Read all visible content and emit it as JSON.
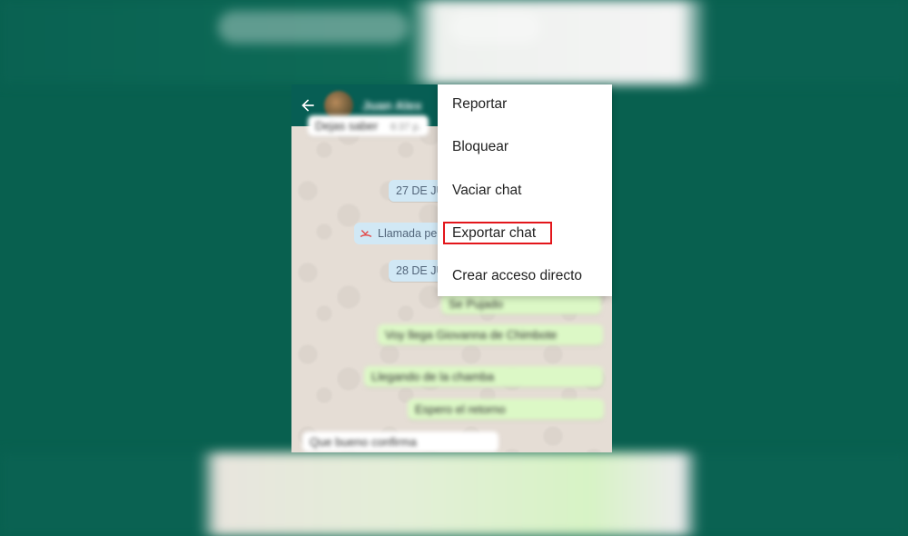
{
  "header": {
    "back_icon": "arrow-back-icon",
    "avatar_icon": "contact-avatar",
    "contact_name": "Juan Alex"
  },
  "chat": {
    "top_message": {
      "text": "Dejas saber",
      "time": "6:37 p."
    },
    "date_1": "27 DE JU",
    "missed_call": {
      "icon": "missed-call-icon",
      "label": "Llamada pe"
    },
    "date_2": "28 DE JU",
    "out_messages": [
      {
        "text": "Se Pujado"
      },
      {
        "text": "Voy llega Giovanna de Chimbote"
      },
      {
        "text": "Llegando de la chamba"
      },
      {
        "text": "Espero el retorno"
      }
    ],
    "in_message": {
      "text": "Que bueno confirma"
    }
  },
  "menu": {
    "items": [
      {
        "label": "Reportar"
      },
      {
        "label": "Bloquear"
      },
      {
        "label": "Vaciar chat"
      },
      {
        "label": "Exportar chat",
        "highlighted": true
      },
      {
        "label": "Crear acceso directo"
      }
    ],
    "highlight_color": "#e3161b"
  },
  "colors": {
    "background": "#08604f",
    "appbar": "#075e54",
    "outgoing_bubble": "#dcf8c6",
    "date_pill": "#d1e8f5"
  }
}
